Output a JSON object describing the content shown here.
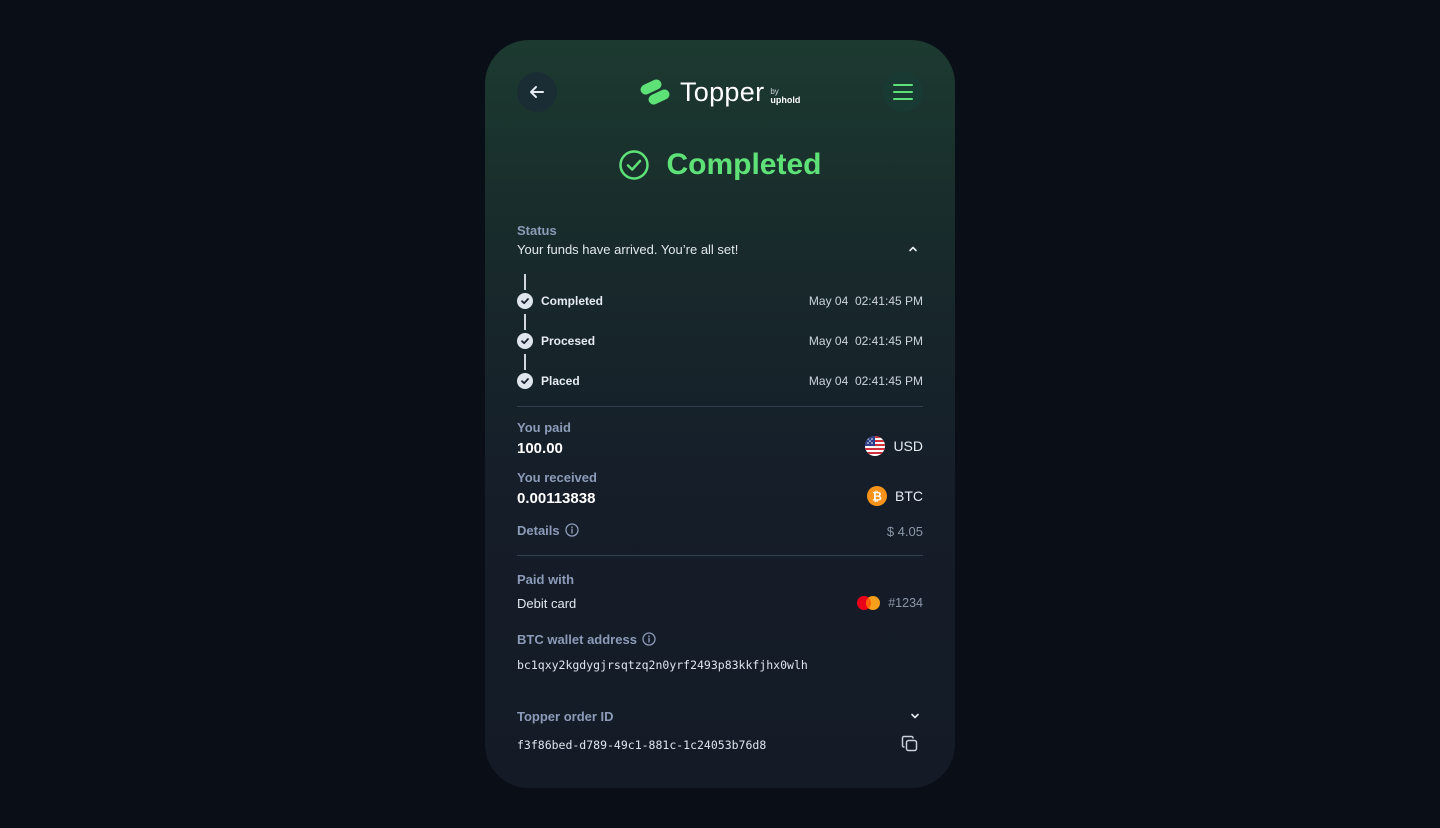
{
  "header": {
    "brand": "Topper",
    "by": "by",
    "partner": "uphold"
  },
  "hero": {
    "title": "Completed"
  },
  "status": {
    "label": "Status",
    "message": "Your funds have arrived. You’re all set!",
    "steps": [
      {
        "label": "Completed",
        "date": "May 04",
        "time": "02:41:45 PM"
      },
      {
        "label": "Procesed",
        "date": "May 04",
        "time": "02:41:45 PM"
      },
      {
        "label": "Placed",
        "date": "May 04",
        "time": "02:41:45 PM"
      }
    ]
  },
  "paid": {
    "label": "You paid",
    "amount": "100.00",
    "currency": "USD"
  },
  "received": {
    "label": "You received",
    "amount": "0.00113838",
    "currency": "BTC"
  },
  "details": {
    "label": "Details",
    "fee": "$ 4.05"
  },
  "payment": {
    "label": "Paid with",
    "method": "Debit card",
    "card_last4": "#1234"
  },
  "wallet": {
    "label": "BTC wallet address",
    "address": "bc1qxy2kgdygjrsqtzq2n0yrf2493p83kkfjhx0wlh"
  },
  "order": {
    "label": "Topper order ID",
    "id": "f3f86bed-d789-49c1-881c-1c24053b76d8"
  },
  "colors": {
    "accent": "#5ee277",
    "background": "#0a0e16",
    "label": "#8c9bb8"
  },
  "icons": [
    "arrow-left-icon",
    "menu-icon",
    "check-circle-icon",
    "chevron-up-icon",
    "check-icon",
    "us-flag-icon",
    "bitcoin-icon",
    "info-icon",
    "mastercard-icon",
    "chevron-down-icon",
    "copy-icon"
  ]
}
